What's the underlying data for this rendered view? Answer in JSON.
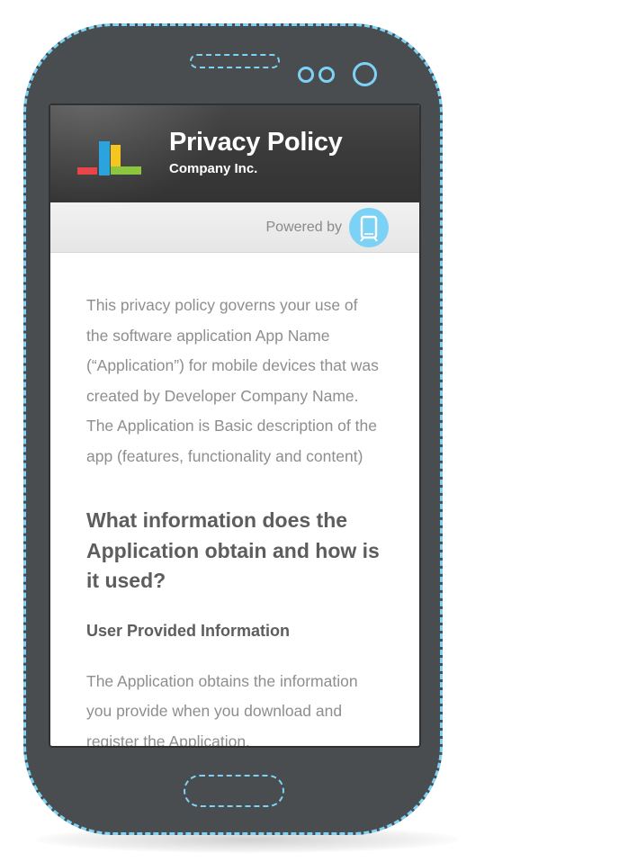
{
  "header": {
    "title": "Privacy Policy",
    "subtitle": "Company Inc."
  },
  "powered_by": {
    "label": "Powered by"
  },
  "content": {
    "intro": "This privacy policy governs your use of the software application App Name (“Application”) for mobile devices that was created by Developer Company Name. The Application is Basic description of the app (features, functionality and content)",
    "section_heading": "What information does the Application obtain and how is it used?",
    "sub_heading": "User Provided Information",
    "body": "The Application obtains the information you provide when you download and register the Application."
  },
  "colors": {
    "device_body": "#4a4d50",
    "device_accent": "#7dd3f5",
    "header_bg": "#3a3a3a",
    "logo_red": "#e8454b",
    "logo_blue": "#2aa3df",
    "logo_yellow": "#f5c520",
    "logo_green": "#8cc63f",
    "text_gray": "#8e8e8e",
    "heading_gray": "#5d5d5d"
  },
  "icons": {
    "app_logo": "bar-chart-logo-icon",
    "powered_logo": "phone-badge-icon"
  }
}
